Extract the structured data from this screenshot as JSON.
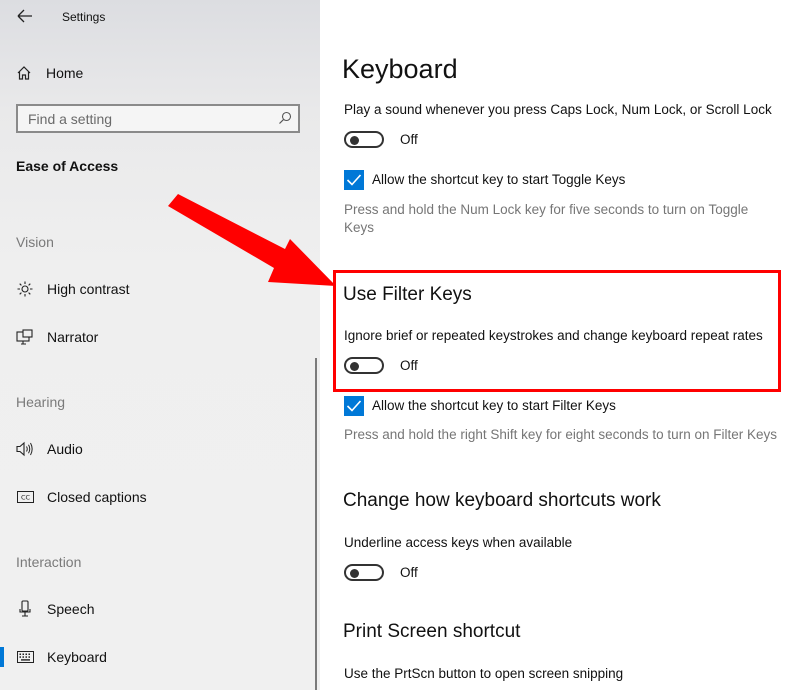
{
  "window": {
    "title": "Settings"
  },
  "sidebar": {
    "home_label": "Home",
    "search": {
      "placeholder": "Find a setting",
      "value": ""
    },
    "section_title": "Ease of Access",
    "groups": [
      {
        "label": "Vision",
        "items": [
          {
            "label": "High contrast",
            "icon": "sun-icon"
          },
          {
            "label": "Narrator",
            "icon": "narrator-icon"
          }
        ]
      },
      {
        "label": "Hearing",
        "items": [
          {
            "label": "Audio",
            "icon": "speaker-icon"
          },
          {
            "label": "Closed captions",
            "icon": "closed-captions-icon"
          }
        ]
      },
      {
        "label": "Interaction",
        "items": [
          {
            "label": "Speech",
            "icon": "microphone-icon"
          },
          {
            "label": "Keyboard",
            "icon": "keyboard-icon",
            "selected": true
          }
        ]
      }
    ],
    "accent_color": "#0078d7"
  },
  "main": {
    "title": "Keyboard",
    "toggle_keys": {
      "sound_label": "Play a sound whenever you press Caps Lock, Num Lock, or Scroll Lock",
      "sound_state": "Off",
      "shortcut_label": "Allow the shortcut key to start Toggle Keys",
      "shortcut_checked": true,
      "shortcut_desc": "Press and hold the Num Lock key for five seconds to turn on Toggle Keys"
    },
    "filter_keys": {
      "heading": "Use Filter Keys",
      "label": "Ignore brief or repeated keystrokes and change keyboard repeat rates",
      "state": "Off",
      "shortcut_label": "Allow the shortcut key to start Filter Keys",
      "shortcut_checked": true,
      "shortcut_desc": "Press and hold the right Shift key for eight seconds to turn on Filter Keys"
    },
    "shortcuts": {
      "heading": "Change how keyboard shortcuts work",
      "underline_label": "Underline access keys when available",
      "underline_state": "Off"
    },
    "print_screen": {
      "heading": "Print Screen shortcut",
      "label": "Use the PrtScn button to open screen snipping"
    }
  },
  "annotation": {
    "color": "#ff0000"
  }
}
